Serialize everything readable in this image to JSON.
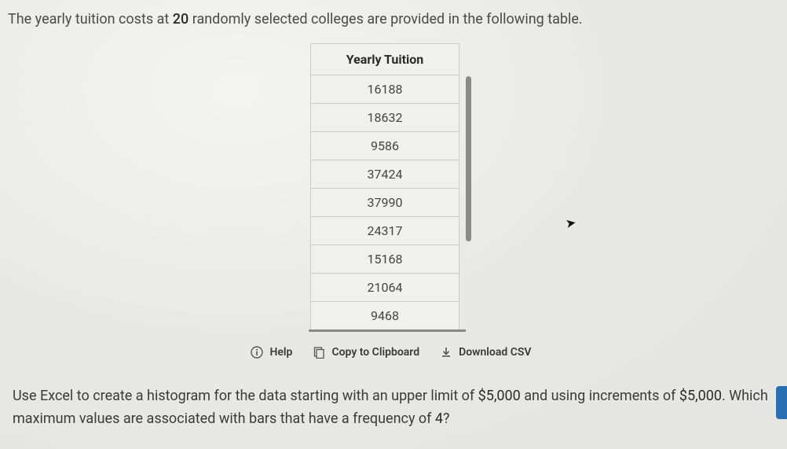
{
  "intro": {
    "prefix": "The yearly tuition costs at ",
    "count": "20",
    "suffix": " randomly selected colleges are provided in the following table."
  },
  "table": {
    "header": "Yearly Tuition",
    "rows": [
      "16188",
      "18632",
      "9586",
      "37424",
      "37990",
      "24317",
      "15168",
      "21064",
      "9468"
    ]
  },
  "toolbar": {
    "help_label": "Help",
    "copy_label": "Copy to Clipboard",
    "download_label": "Download CSV"
  },
  "question": {
    "part1": "Use Excel to create a histogram for the data starting with an upper limit of ",
    "amount1": "$5,000",
    "part2": " and using increments of ",
    "amount2": "$5,000",
    "part3": ". Which maximum values are associated with bars that have a frequency of ",
    "freq": "4",
    "part4": "?"
  }
}
